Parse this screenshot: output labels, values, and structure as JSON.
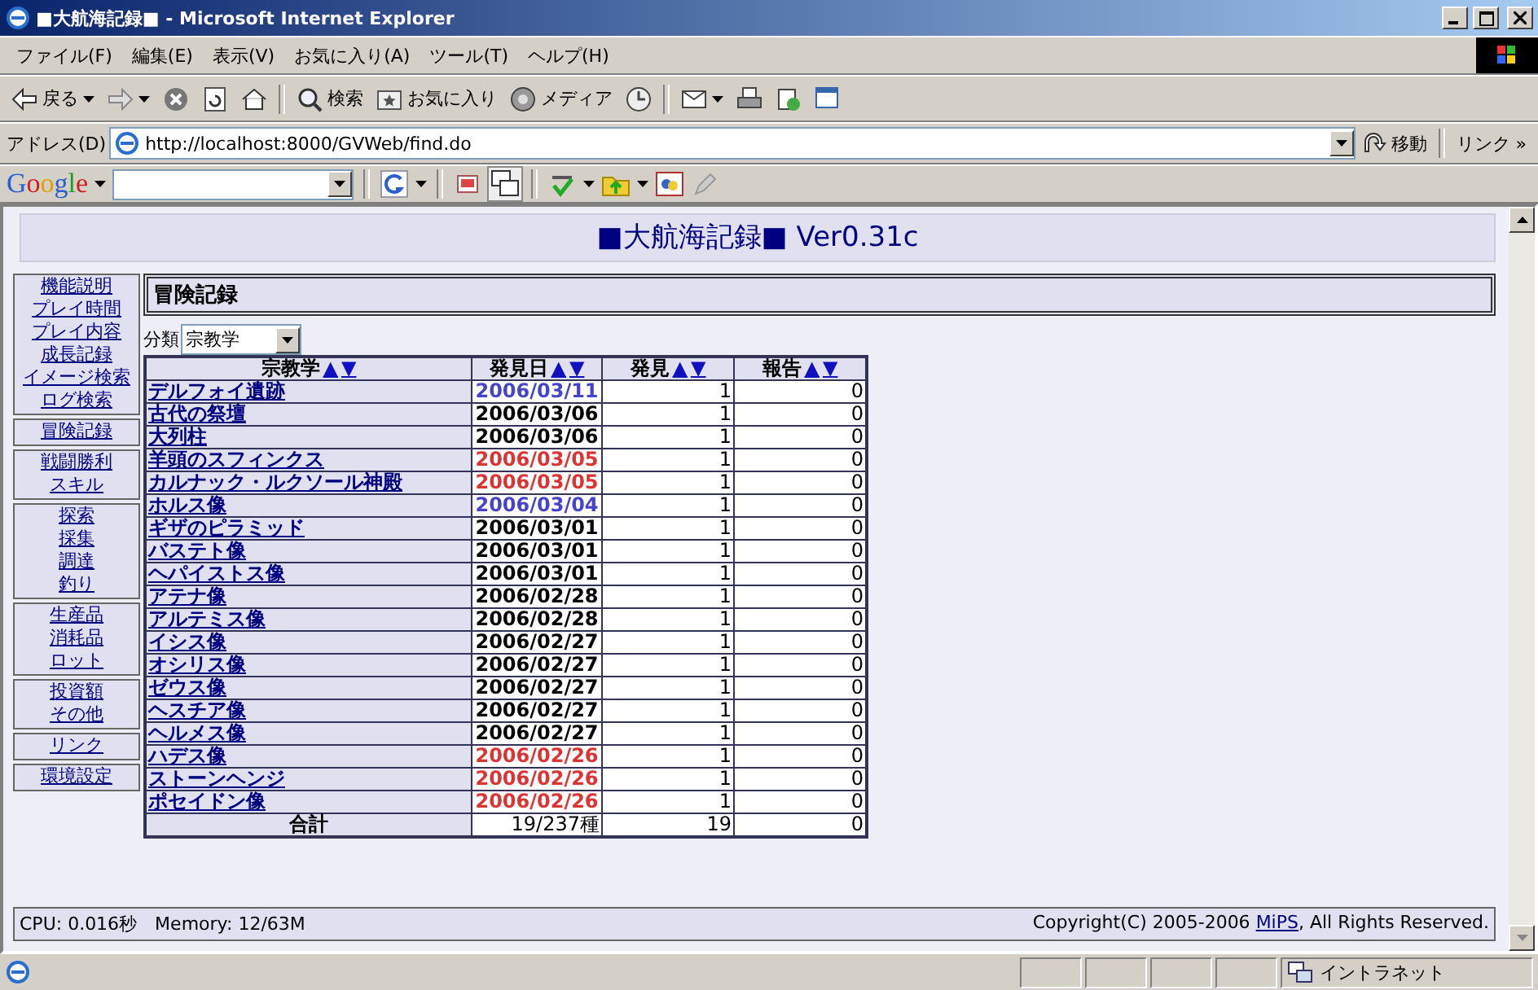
{
  "window": {
    "title": "■大航海記録■ - Microsoft Internet Explorer"
  },
  "menu": [
    "ファイル(F)",
    "編集(E)",
    "表示(V)",
    "お気に入り(A)",
    "ツール(T)",
    "ヘルプ(H)"
  ],
  "toolbar": [
    {
      "kind": "back",
      "label": "戻る"
    },
    {
      "kind": "forward"
    },
    {
      "kind": "stop"
    },
    {
      "kind": "refresh"
    },
    {
      "kind": "home"
    },
    {
      "kind": "sep"
    },
    {
      "kind": "search",
      "label": "検索"
    },
    {
      "kind": "favorites",
      "label": "お気に入り"
    },
    {
      "kind": "media",
      "label": "メディア"
    },
    {
      "kind": "history"
    },
    {
      "kind": "sep"
    },
    {
      "kind": "mail"
    },
    {
      "kind": "print"
    },
    {
      "kind": "edit"
    },
    {
      "kind": "discuss"
    }
  ],
  "address": {
    "label": "アドレス(D)",
    "url": "http://localhost:8000/GVWeb/find.do",
    "go": "移動",
    "links": "リンク",
    "more": "»"
  },
  "google": {
    "logo": "Google"
  },
  "page": {
    "title": "■大航海記録■ Ver0.31c",
    "sidebar": [
      [
        "機能説明",
        "プレイ時間",
        "プレイ内容",
        "成長記録",
        "イメージ検索",
        "ログ検索"
      ],
      [
        "冒険記録"
      ],
      [
        "戦闘勝利",
        "スキル"
      ],
      [
        "探索",
        "採集",
        "調達",
        "釣り"
      ],
      [
        "生産品",
        "消耗品",
        "ロット"
      ],
      [
        "投資額",
        "その他"
      ],
      [
        "リンク"
      ],
      [
        "環境設定"
      ]
    ],
    "section": "冒険記録",
    "filter": {
      "label": "分類",
      "value": "宗教学"
    },
    "columns": [
      {
        "label": "宗教学",
        "up": "▲",
        "down": "▼"
      },
      {
        "label": "発見日",
        "up": "▲",
        "down": "▼"
      },
      {
        "label": "発見",
        "up": "▲",
        "down": "▼"
      },
      {
        "label": "報告",
        "up": "▲",
        "down": "▼"
      }
    ],
    "rows": [
      {
        "name": "デルフォイ遺跡",
        "date": "2006/03/11",
        "color": "#4444cc",
        "found": "1",
        "reported": "0"
      },
      {
        "name": "古代の祭壇",
        "date": "2006/03/06",
        "color": "#000000",
        "found": "1",
        "reported": "0"
      },
      {
        "name": "大列柱",
        "date": "2006/03/06",
        "color": "#000000",
        "found": "1",
        "reported": "0"
      },
      {
        "name": "羊頭のスフィンクス",
        "date": "2006/03/05",
        "color": "#dd3333",
        "found": "1",
        "reported": "0"
      },
      {
        "name": "カルナック・ルクソール神殿",
        "date": "2006/03/05",
        "color": "#dd3333",
        "found": "1",
        "reported": "0"
      },
      {
        "name": "ホルス像",
        "date": "2006/03/04",
        "color": "#4444cc",
        "found": "1",
        "reported": "0"
      },
      {
        "name": "ギザのピラミッド",
        "date": "2006/03/01",
        "color": "#000000",
        "found": "1",
        "reported": "0"
      },
      {
        "name": "バステト像",
        "date": "2006/03/01",
        "color": "#000000",
        "found": "1",
        "reported": "0"
      },
      {
        "name": "ヘパイストス像",
        "date": "2006/03/01",
        "color": "#000000",
        "found": "1",
        "reported": "0"
      },
      {
        "name": "アテナ像",
        "date": "2006/02/28",
        "color": "#000000",
        "found": "1",
        "reported": "0"
      },
      {
        "name": "アルテミス像",
        "date": "2006/02/28",
        "color": "#000000",
        "found": "1",
        "reported": "0"
      },
      {
        "name": "イシス像",
        "date": "2006/02/27",
        "color": "#000000",
        "found": "1",
        "reported": "0"
      },
      {
        "name": "オシリス像",
        "date": "2006/02/27",
        "color": "#000000",
        "found": "1",
        "reported": "0"
      },
      {
        "name": "ゼウス像",
        "date": "2006/02/27",
        "color": "#000000",
        "found": "1",
        "reported": "0"
      },
      {
        "name": "ヘスチア像",
        "date": "2006/02/27",
        "color": "#000000",
        "found": "1",
        "reported": "0"
      },
      {
        "name": "ヘルメス像",
        "date": "2006/02/27",
        "color": "#000000",
        "found": "1",
        "reported": "0"
      },
      {
        "name": "ハデス像",
        "date": "2006/02/26",
        "color": "#dd3333",
        "found": "1",
        "reported": "0"
      },
      {
        "name": "ストーンヘンジ",
        "date": "2006/02/26",
        "color": "#dd3333",
        "found": "1",
        "reported": "0"
      },
      {
        "name": "ポセイドン像",
        "date": "2006/02/26",
        "color": "#dd3333",
        "found": "1",
        "reported": "0"
      }
    ],
    "total": {
      "label": "合計",
      "count": "19/237種",
      "found": "19",
      "reported": "0"
    },
    "footer": {
      "stats": "CPU: 0.016秒　Memory: 12/63M",
      "copyright_before": "Copyright(C) 2005-2006 ",
      "copyright_link": "MiPS",
      "copyright_after": ", All Rights Reserved."
    }
  },
  "status_bar": {
    "zone": "イントラネット"
  }
}
